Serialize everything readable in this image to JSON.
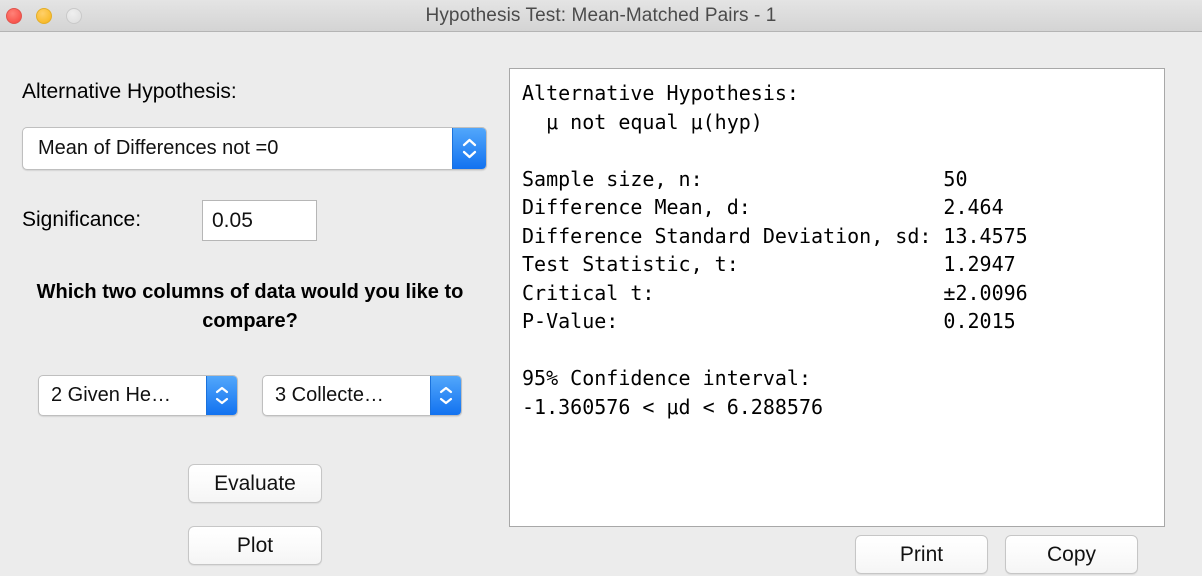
{
  "window": {
    "title": "Hypothesis Test: Mean-Matched Pairs - 1",
    "traffic_lights": {
      "close_color": "#f9564e",
      "minimize_color": "#f9bc2e",
      "zoom_color": "#e2e2e2"
    }
  },
  "controls": {
    "alt_hypothesis_label": "Alternative Hypothesis:",
    "alt_hypothesis_value": "Mean of Differences not =0",
    "significance_label": "Significance:",
    "significance_value": "0.05",
    "compare_question": "Which two columns of data would you like to compare?",
    "column_1_value": "2 Given He…",
    "column_2_value": "3 Collecte…",
    "accent_color": "#1272f0"
  },
  "buttons": {
    "evaluate": "Evaluate",
    "plot": "Plot",
    "print": "Print",
    "copy": "Copy"
  },
  "results": {
    "heading": "Alternative Hypothesis:",
    "heading_detail": "μ not equal μ(hyp)",
    "rows": [
      {
        "label": "Sample size, n:",
        "value": "50"
      },
      {
        "label": "Difference Mean, d:",
        "value": "2.464"
      },
      {
        "label": "Difference Standard Deviation, sd:",
        "value": "13.4575"
      },
      {
        "label": "Test Statistic, t:",
        "value": "1.2947"
      },
      {
        "label": "Critical t:",
        "value": "±2.0096"
      },
      {
        "label": "P-Value:",
        "value": "0.2015"
      }
    ],
    "ci_heading": "95% Confidence interval:",
    "ci_interval": "-1.360576 < μd < 6.288576",
    "text": "Alternative Hypothesis:\n  μ not equal μ(hyp)\n\nSample size, n:                    50\nDifference Mean, d:                2.464\nDifference Standard Deviation, sd: 13.4575\nTest Statistic, t:                 1.2947\nCritical t:                        ±2.0096\nP-Value:                           0.2015\n\n95% Confidence interval:\n-1.360576 < μd < 6.288576"
  }
}
